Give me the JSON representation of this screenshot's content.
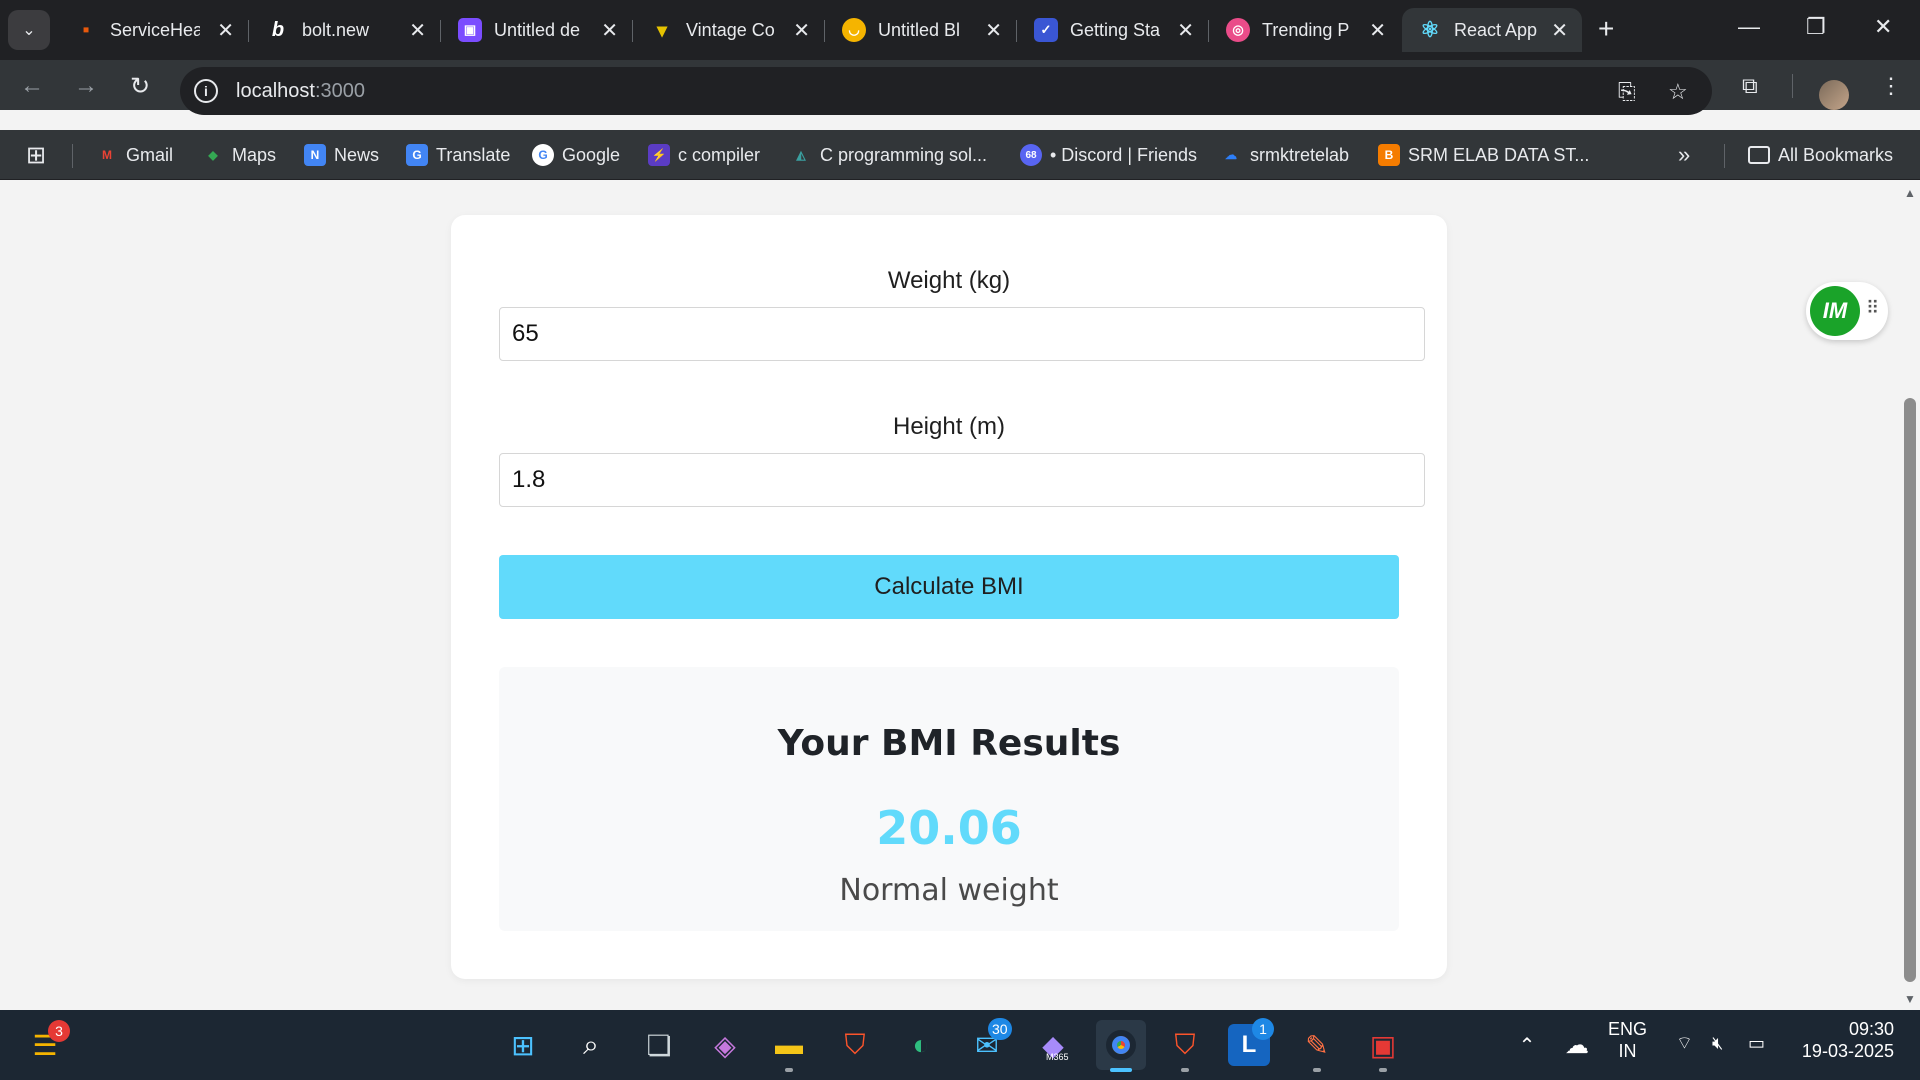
{
  "browser": {
    "tabs": [
      {
        "title": "ServiceHea",
        "color": "#e8590c",
        "glyph": "▪"
      },
      {
        "title": "bolt.new",
        "color": "#202124",
        "glyph": "b"
      },
      {
        "title": "Untitled de",
        "color": "#7b4dff",
        "glyph": "▣"
      },
      {
        "title": "Vintage Co",
        "color": "#e5c200",
        "glyph": "▾"
      },
      {
        "title": "Untitled Bl",
        "color": "#f5b400",
        "glyph": "◡"
      },
      {
        "title": "Getting Sta",
        "color": "#3a56d4",
        "glyph": "✓"
      },
      {
        "title": "Trending P",
        "color": "#ea4c89",
        "glyph": "◎"
      },
      {
        "title": "React App",
        "color": "#323639",
        "glyph": "⚛"
      }
    ],
    "url_host": "localhost",
    "url_port": ":3000",
    "bookmarks": [
      {
        "label": "Gmail",
        "color": "#ea4335",
        "glyph": "M"
      },
      {
        "label": "Maps",
        "color": "#34a853",
        "glyph": "◆"
      },
      {
        "label": "News",
        "color": "#4285f4",
        "glyph": "N"
      },
      {
        "label": "Translate",
        "color": "#4285f4",
        "glyph": "G"
      },
      {
        "label": "Google",
        "color": "#ffffff",
        "glyph": "G"
      },
      {
        "label": "c compiler",
        "color": "#5b3cc4",
        "glyph": "⚡"
      },
      {
        "label": "C programming sol...",
        "color": "#0b6e6e",
        "glyph": "◭"
      },
      {
        "label": "• Discord | Friends",
        "color": "#5865f2",
        "glyph": "68"
      },
      {
        "label": "srmktretelab",
        "color": "#2d7ff9",
        "glyph": "☁"
      },
      {
        "label": "SRM ELAB DATA ST...",
        "color": "#f57c00",
        "glyph": "B"
      }
    ],
    "all_bookmarks": "All Bookmarks"
  },
  "app": {
    "weight_label": "Weight (kg)",
    "weight_value": "65",
    "height_label": "Height (m)",
    "height_value": "1.8",
    "button_label": "Calculate BMI",
    "results_title": "Your BMI Results",
    "bmi_value": "20.06",
    "bmi_status": "Normal weight",
    "accent": "#61dafb"
  },
  "widget": {
    "logo": "IM"
  },
  "taskbar": {
    "notification_count": "3",
    "mail_badge": "30",
    "copilot_label": "M365",
    "l_badge": "1",
    "lang_top": "ENG",
    "lang_bottom": "IN",
    "time": "09:30",
    "date": "19-03-2025"
  }
}
